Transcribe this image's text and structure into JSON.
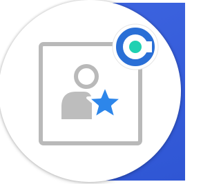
{
  "icon": {
    "name": "profile-favorite-app-icon",
    "badge_name": "c-logo-badge",
    "colors": {
      "frame": "#b9b9b9",
      "person": "#bdbdbd",
      "star": "#2d86ea",
      "badge_ring": "#2a6fd6",
      "badge_dot": "#1fd1b2",
      "band": "#3c63df"
    }
  }
}
